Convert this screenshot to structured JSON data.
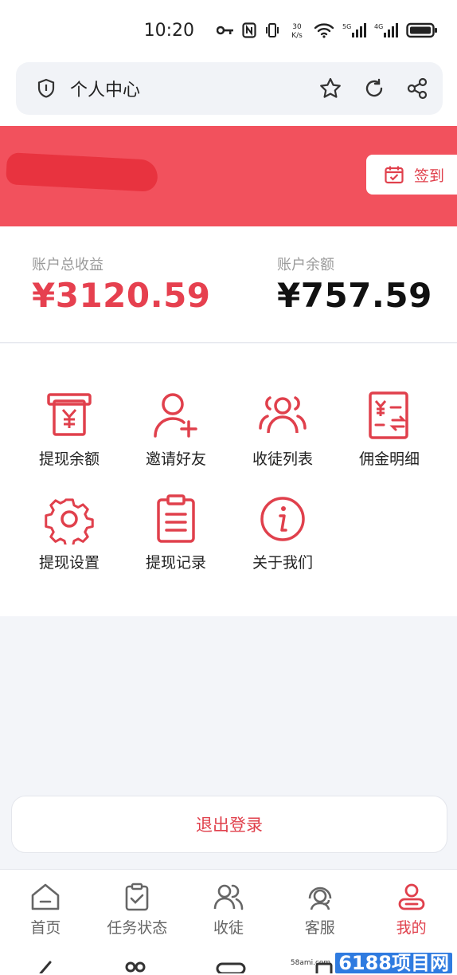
{
  "status_bar": {
    "time": "10:20",
    "network_speed": "30\nK/s",
    "icons": [
      "key-icon",
      "nfc-icon",
      "vibrate-icon",
      "network-speed-icon",
      "wifi-icon",
      "signal-5g-icon",
      "signal-4g-icon",
      "battery-icon"
    ]
  },
  "browser": {
    "title": "个人中心",
    "icons": [
      "shield-icon",
      "star-icon",
      "refresh-icon",
      "share-icon"
    ]
  },
  "header": {
    "signin_label": "签到",
    "username_redacted": true,
    "colors": {
      "accent": "#f2515d",
      "accent_text": "#e0404c"
    }
  },
  "stats": {
    "total_label": "账户总收益",
    "total_value": "¥3120.59",
    "balance_label": "账户余额",
    "balance_value": "¥757.59"
  },
  "menu": [
    {
      "label": "提现余额",
      "icon": "atm-yen-icon"
    },
    {
      "label": "邀请好友",
      "icon": "add-user-icon"
    },
    {
      "label": "收徒列表",
      "icon": "users-group-icon"
    },
    {
      "label": "佣金明细",
      "icon": "commission-icon"
    },
    {
      "label": "提现设置",
      "icon": "gear-icon"
    },
    {
      "label": "提现记录",
      "icon": "clipboard-icon"
    },
    {
      "label": "关于我们",
      "icon": "info-icon"
    }
  ],
  "logout_label": "退出登录",
  "tabs": [
    {
      "label": "首页",
      "icon": "home-icon",
      "active": false
    },
    {
      "label": "任务状态",
      "icon": "task-clipboard-icon",
      "active": false
    },
    {
      "label": "收徒",
      "icon": "users-icon",
      "active": false
    },
    {
      "label": "客服",
      "icon": "headset-icon",
      "active": false
    },
    {
      "label": "我的",
      "icon": "profile-icon",
      "active": true
    }
  ],
  "watermark": {
    "sub": "58ami.com",
    "main": "6188项目网"
  }
}
